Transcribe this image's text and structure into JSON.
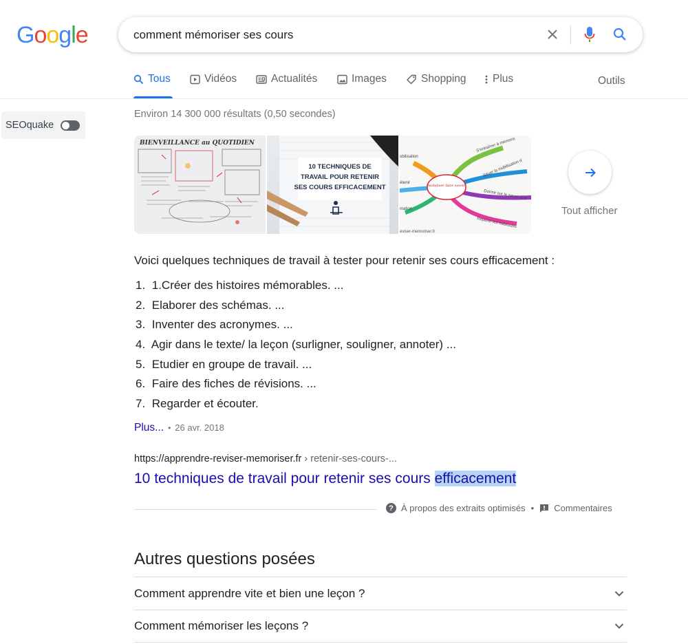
{
  "logo": {
    "letters": [
      "G",
      "o",
      "o",
      "g",
      "l",
      "e"
    ],
    "colors": [
      "#4285f4",
      "#ea4335",
      "#fbbc05",
      "#4285f4",
      "#34a853",
      "#ea4335"
    ]
  },
  "search": {
    "query": "comment mémoriser ses cours",
    "clear_icon": "close-icon",
    "voice_icon": "mic-icon",
    "search_icon": "search-icon"
  },
  "tabs": [
    {
      "label": "Tous",
      "icon": "search-icon",
      "active": true
    },
    {
      "label": "Vidéos",
      "icon": "play-icon"
    },
    {
      "label": "Actualités",
      "icon": "news-icon"
    },
    {
      "label": "Images",
      "icon": "image-icon"
    },
    {
      "label": "Shopping",
      "icon": "tag-icon"
    },
    {
      "label": "Plus",
      "icon": "more-vert-icon"
    }
  ],
  "tools_label": "Outils",
  "seoquake": {
    "label": "SEOquake",
    "enabled": false
  },
  "stats": "Environ 14 300 000 résultats (0,50 secondes)",
  "images": {
    "thumb1": {
      "heading": "BIENVEILLANCE au QUOTIDIEN"
    },
    "thumb2": {
      "line1": "10 TECHNIQUES DE",
      "line2": "TRAVAIL POUR RETENIR",
      "line3": "SES COURS EFFICACEMENT"
    },
    "thumb3": {
      "center": "\"mobiliser faire savoir\"",
      "b1": "S'entraîner à mémoris",
      "b2": "Situer la mobilisation d",
      "b3": "Dormir sur le savoir à m",
      "b4": "Repérer les habitudes",
      "l1": "obilisation",
      "l2": "étenir",
      "l3": "mation",
      "footer": "eviser-memoriser.fr"
    },
    "show_all_label": "Tout afficher"
  },
  "snippet": {
    "intro": "Voici quelques techniques de travail à tester pour retenir ses cours efficacement :",
    "steps": [
      {
        "num": "1.",
        "text": "1.Créer des histoires mémorables. ..."
      },
      {
        "num": "2.",
        "text": "Elaborer des schémas. ..."
      },
      {
        "num": "3.",
        "text": "Inventer des acronymes. ..."
      },
      {
        "num": "4.",
        "text": "Agir dans le texte/ la leçon (surligner, souligner, annoter) ..."
      },
      {
        "num": "5.",
        "text": "Etudier en groupe de travail. ..."
      },
      {
        "num": "6.",
        "text": "Faire des fiches de révisions. ..."
      },
      {
        "num": "7.",
        "text": "Regarder et écouter."
      }
    ],
    "more": "Plus...",
    "separator": "•",
    "date": "26 avr. 2018"
  },
  "result": {
    "url_host": "https://apprendre-reviser-memoriser.fr",
    "url_crumb": " › retenir-ses-cours-...",
    "title_main": "10 techniques de travail pour retenir ses cours ",
    "title_highlight": "efficacement"
  },
  "footer": {
    "about": "À propos des extraits optimisés",
    "separator": "•",
    "feedback": "Commentaires"
  },
  "paa": {
    "title": "Autres questions posées",
    "questions": [
      "Comment apprendre vite et bien une leçon ?",
      "Comment mémoriser les leçons ?"
    ]
  }
}
